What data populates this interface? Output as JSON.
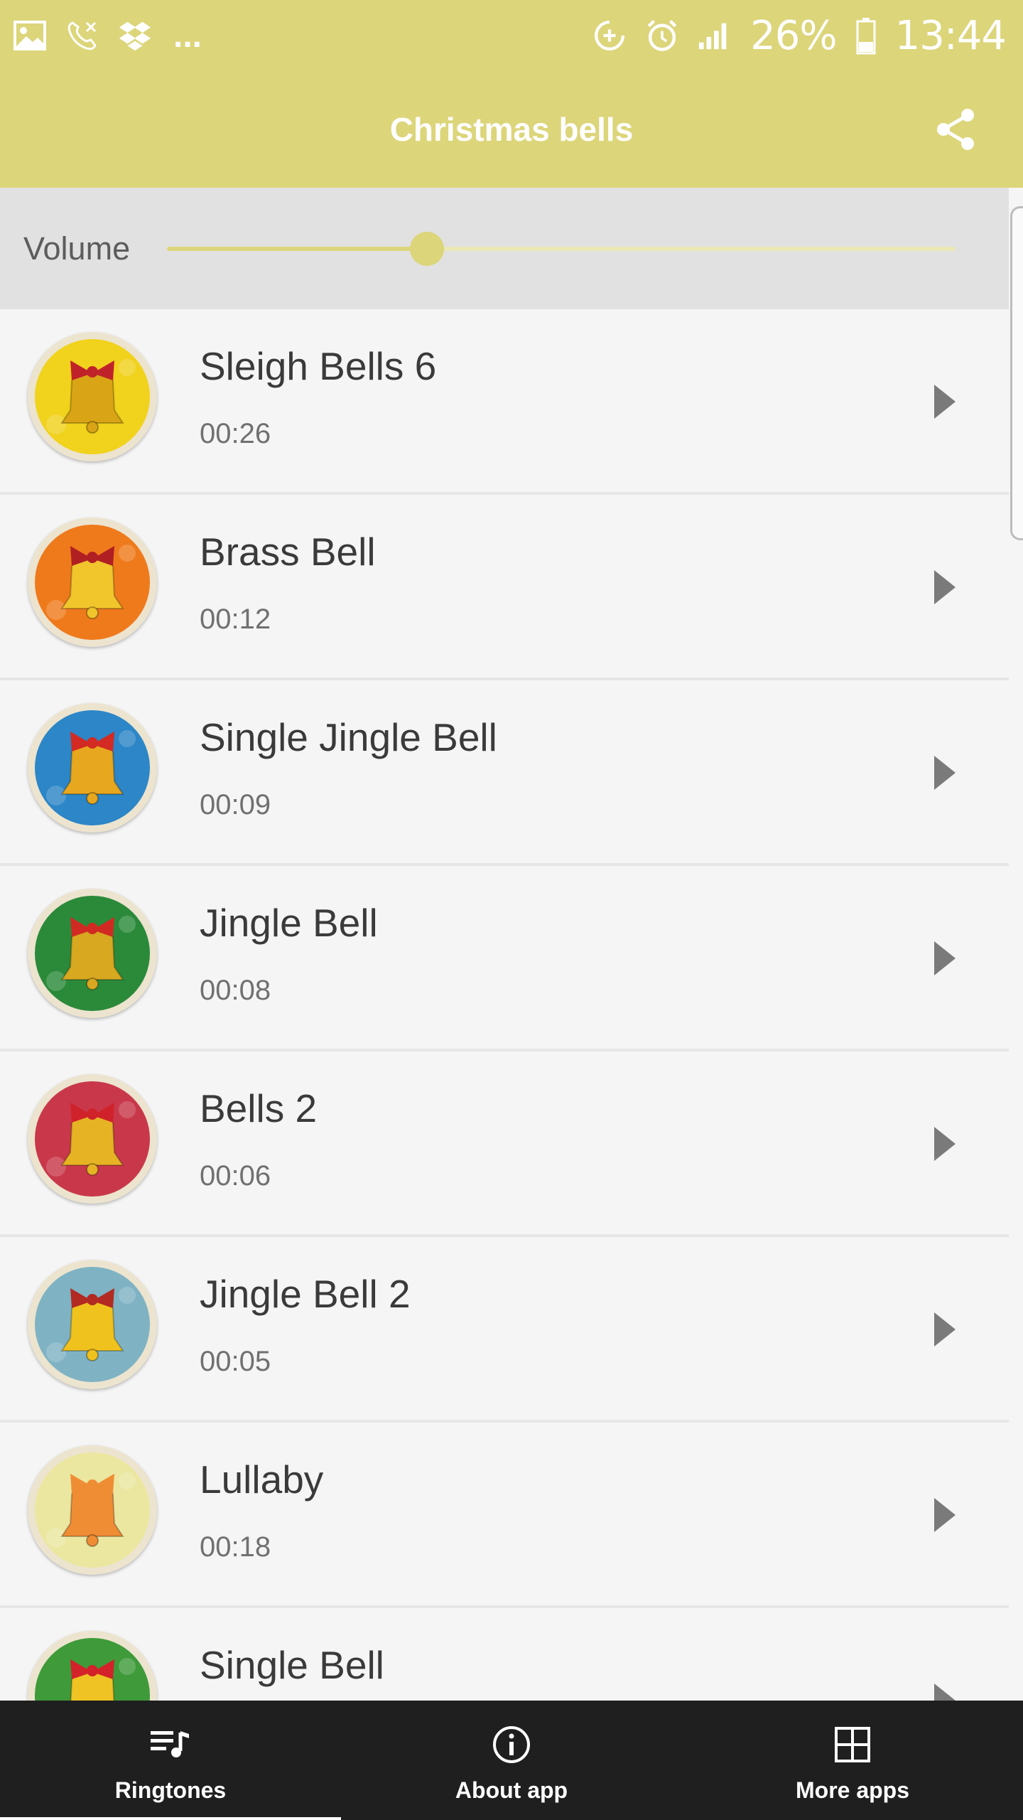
{
  "status_bar": {
    "left_icons": [
      "image-icon",
      "missed-call-icon",
      "dropbox-icon"
    ],
    "more": "...",
    "right_icons": [
      "sync-add-icon",
      "alarm-icon",
      "signal-icon",
      "battery-icon"
    ],
    "battery": "26%",
    "time": "13:44"
  },
  "app_bar": {
    "title": "Christmas bells",
    "share_icon": "share-icon"
  },
  "volume": {
    "label": "Volume",
    "level": 0.33,
    "accent_color": "#dcd57a"
  },
  "ringtones": [
    {
      "title": "Sleigh Bells 6",
      "duration": "00:26",
      "bg": "#f1d21c",
      "bell": "#d9a516",
      "bow": "#c0222a"
    },
    {
      "title": "Brass Bell",
      "duration": "00:12",
      "bg": "#ef7a1c",
      "bell": "#f1c52c",
      "bow": "#b01f22"
    },
    {
      "title": "Single Jingle Bell",
      "duration": "00:09",
      "bg": "#2c86c7",
      "bell": "#e7a71e",
      "bow": "#d32a23"
    },
    {
      "title": "Jingle Bell",
      "duration": "00:08",
      "bg": "#2b8a3a",
      "bell": "#d7a820",
      "bow": "#d12a22"
    },
    {
      "title": "Bells 2",
      "duration": "00:06",
      "bg": "#c9384a",
      "bell": "#e6b324",
      "bow": "#d0222a"
    },
    {
      "title": "Jingle Bell 2",
      "duration": "00:05",
      "bg": "#7fb3c4",
      "bell": "#f0c21e",
      "bow": "#b22a22"
    },
    {
      "title": "Lullaby",
      "duration": "00:18",
      "bg": "#ebe7a0",
      "bell": "#ef8d35",
      "bow": "#ef8d35"
    },
    {
      "title": "Single Bell",
      "duration": "",
      "bg": "#3f9a3a",
      "bell": "#efc323",
      "bow": "#d3222a"
    }
  ],
  "bottom_nav": [
    {
      "label": "Ringtones",
      "icon": "playlist-icon",
      "active": true
    },
    {
      "label": "About app",
      "icon": "info-icon",
      "active": false
    },
    {
      "label": "More apps",
      "icon": "grid-icon",
      "active": false
    }
  ]
}
